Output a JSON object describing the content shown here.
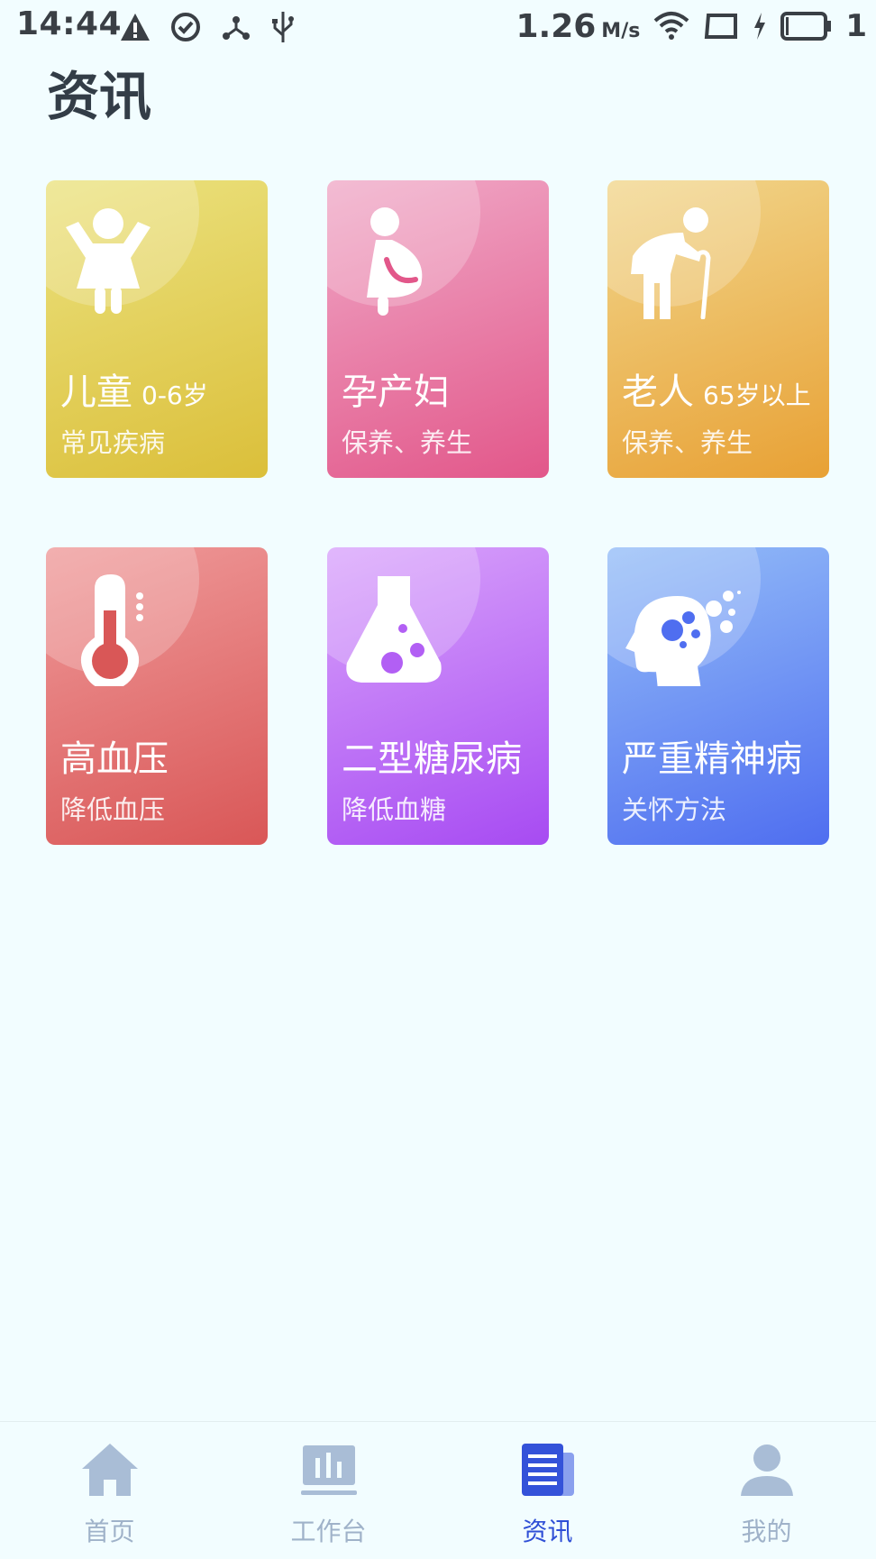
{
  "status_bar": {
    "time": "14:44",
    "speed": "1.26",
    "speed_unit": "M/s",
    "battery": "1",
    "icons": [
      "warning-icon",
      "check-circle-icon",
      "share-hub-icon",
      "usb-icon",
      "wifi-icon",
      "screen-icon",
      "charging-icon",
      "battery-icon"
    ]
  },
  "page": {
    "title": "资讯"
  },
  "cards": [
    {
      "title": "儿童",
      "age": "0-6岁",
      "subtitle": "常见疾病",
      "icon": "child-icon",
      "color_from": "#ebe27f",
      "color_to": "#dbbf3a"
    },
    {
      "title": "孕产妇",
      "age": "",
      "subtitle": "保养、养生",
      "icon": "pregnant-woman-icon",
      "color_from": "#f0a9c7",
      "color_to": "#e2578a"
    },
    {
      "title": "老人",
      "age": "65岁以上",
      "subtitle": "保养、养生",
      "icon": "elderly-icon",
      "color_from": "#f1d68c",
      "color_to": "#e8a135"
    },
    {
      "title": "高血压",
      "age": "",
      "subtitle": "降低血压",
      "icon": "thermometer-icon",
      "color_from": "#ef9a9a",
      "color_to": "#d95757"
    },
    {
      "title": "二型糖尿病",
      "age": "",
      "subtitle": "降低血糖",
      "icon": "flask-icon",
      "color_from": "#d9a3fb",
      "color_to": "#a74bf2"
    },
    {
      "title": "严重精神病",
      "age": "",
      "subtitle": "关怀方法",
      "icon": "head-bubbles-icon",
      "color_from": "#94bdf8",
      "color_to": "#4f6ef0"
    }
  ],
  "tabs": [
    {
      "label": "首页",
      "icon": "home-icon",
      "active": false
    },
    {
      "label": "工作台",
      "icon": "workbench-icon",
      "active": false
    },
    {
      "label": "资讯",
      "icon": "news-icon",
      "active": true
    },
    {
      "label": "我的",
      "icon": "profile-icon",
      "active": false
    }
  ],
  "colors": {
    "background": "#f2fdff",
    "tab_active": "#2f4fd6",
    "tab_inactive": "#9fb2c9"
  }
}
